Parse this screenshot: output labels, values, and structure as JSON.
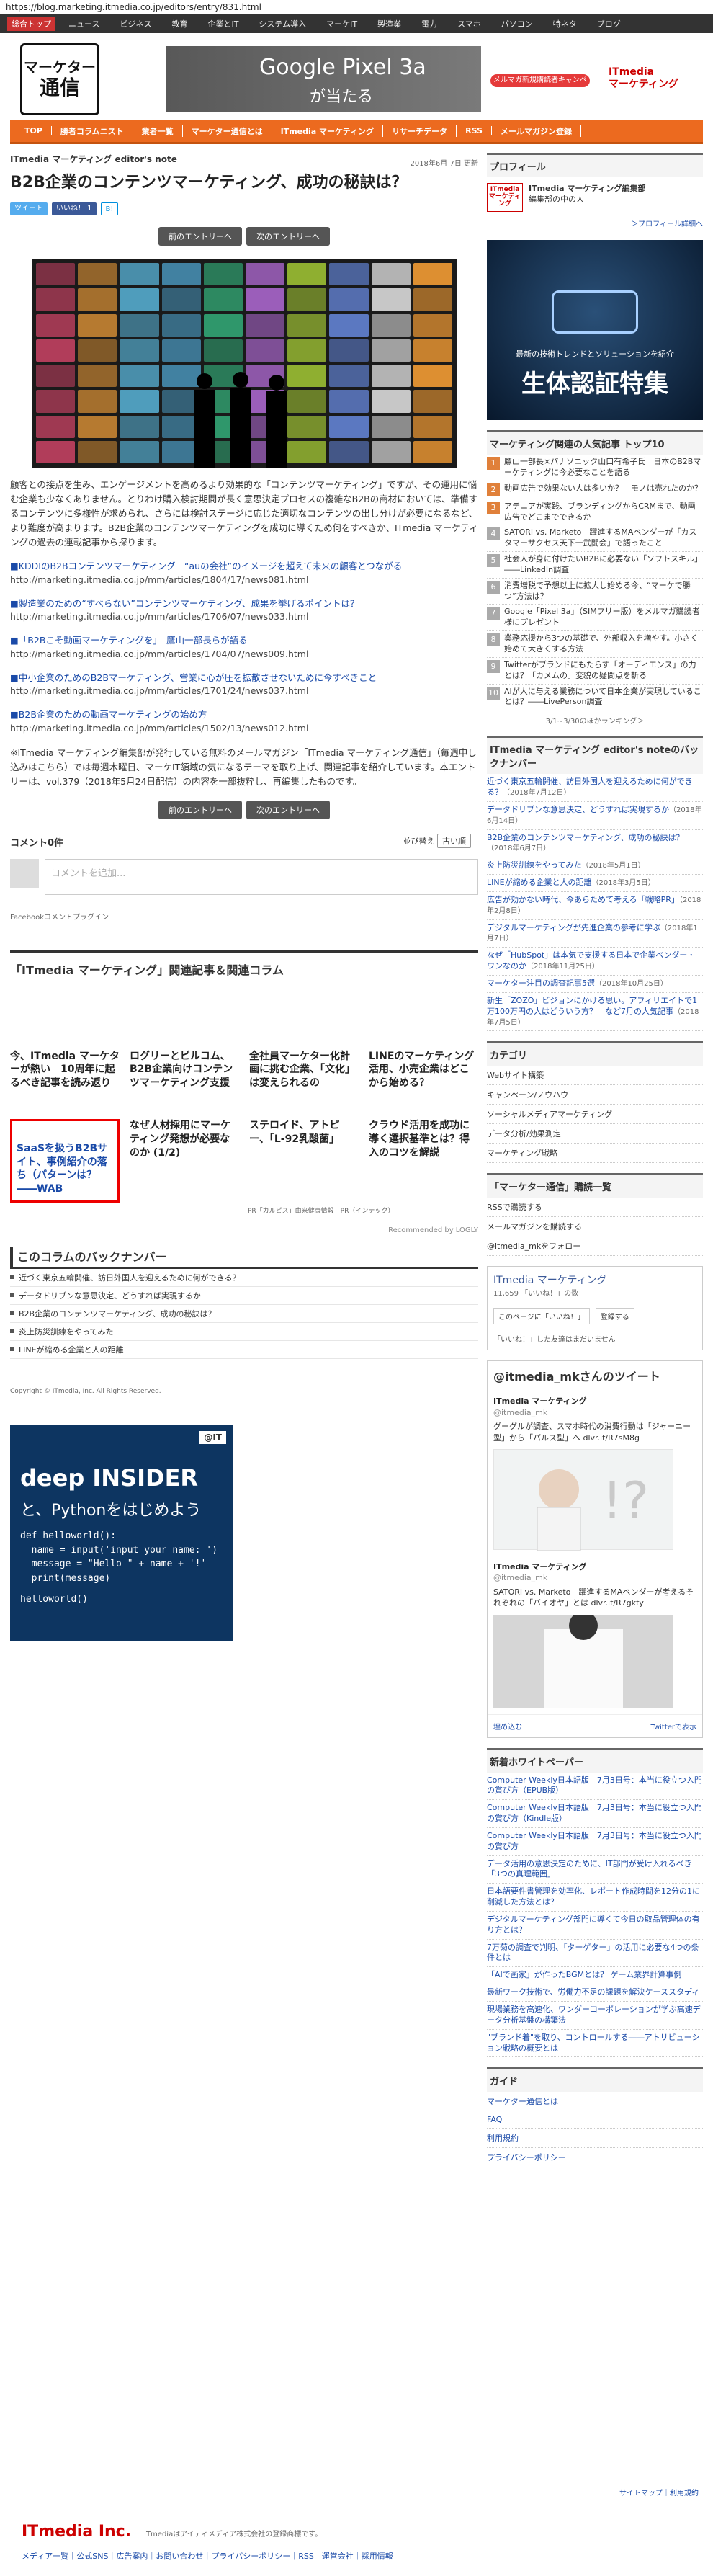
{
  "url": "https://blog.marketing.itmedia.co.jp/editors/entry/831.html",
  "topnav": [
    "総合トップ",
    "ニュース",
    "ビジネス",
    "教育",
    "企業とIT",
    "システム導入",
    "マーケIT",
    "製造業",
    "電力",
    "スマホ",
    "パソコン",
    "特ネタ",
    "ブログ"
  ],
  "logo": {
    "l1": "マーケター",
    "l2": "通信"
  },
  "banner": {
    "t1": "Google Pixel 3a",
    "t2": "が当たる",
    "cta": "メルマガ新規購読者キャンペーン",
    "brand1": "ITmedia",
    "brand2": "マーケティング"
  },
  "orangenav": [
    "TOP",
    "勝者コラムニスト",
    "業者一覧",
    "マーケター通信とは",
    "ITmedia マーケティング",
    "リサーチデータ",
    "RSS",
    "メールマガジン登録"
  ],
  "article": {
    "eyebrow": "ITmedia マーケティング editor's note",
    "date": "2018年6月 7日 更新",
    "title": "B2B企業のコンテンツマーケティング、成功の秘訣は？",
    "tweet": "ツイート",
    "like": "いいね！ 1",
    "hatena": "B!",
    "prev": "前のエントリーへ",
    "next": "次のエントリーへ",
    "para1": "顧客との接点を生み、エンゲージメントを高めるより効果的な「コンテンツマーケティング」ですが、その運用に悩む企業も少なくありません。とりわけ購入検討期間が長く意思決定プロセスの複雑なB2Bの商材においては、準備するコンテンツに多様性が求められ、さらには検討ステージに応じた適切なコンテンツの出し分けが必要になるなど、より難度が高まります。B2B企業のコンテンツマーケティングを成功に導くため何をすべきか、ITmedia マーケティングの過去の連載記事から探ります。",
    "links": [
      {
        "h": "■KDDIのB2Bコンテンツマーケティング　“auの会社”のイメージを超えて未来の顧客とつながる",
        "u": "http://marketing.itmedia.co.jp/mm/articles/1804/17/news081.html"
      },
      {
        "h": "■製造業のための“すべらない”コンテンツマーケティング、成果を挙げるポイントは？",
        "u": "http://marketing.itmedia.co.jp/mm/articles/1706/07/news033.html"
      },
      {
        "h": "■「B2Bこそ動画マーケティングを」　鷹山一部長らが語る",
        "u": "http://marketing.itmedia.co.jp/mm/articles/1704/07/news009.html"
      },
      {
        "h": "■中小企業のためのB2Bマーケティング、営業に心が圧を拡散させないために今すべきこと",
        "u": "http://marketing.itmedia.co.jp/mm/articles/1701/24/news037.html"
      },
      {
        "h": "■B2B企業のための動画マーケティングの始め方",
        "u": "http://marketing.itmedia.co.jp/mm/articles/1502/13/news012.html"
      }
    ],
    "para2": "※ITmedia マーケティング編集部が発行している無料のメールマガジン「ITmedia マーケティング通信」（毎週申し込みはこちら）では毎週木曜日、マーケIT領域の気になるテーマを取り上げ、関連記事を紹介しています。本エントリーは、vol.379（2018年5月24日配信）の内容を一部抜粋し、再編集したものです。"
  },
  "comments": {
    "title": "コメント0件",
    "sort_label": "並び替え",
    "sort_value": "古い順",
    "placeholder": "コメントを追加...",
    "plugin": "Facebookコメントプラグイン"
  },
  "related": {
    "title": "「ITmedia マーケティング」関連記事＆関連コラム",
    "row1": [
      "今、ITmedia マーケターが熱い　10周年に起るべき記事を読み返り",
      "ログリーとビルコム、B2B企業向けコンテンツマーケティング支援",
      "全社員マーケター化計画に挑む企業、「文化」は変えられるの",
      "LINEのマーケティング活用、小売企業はどこから始める？"
    ],
    "row2": [
      "SaaSを扱うB2Bサイト、事例紹介の落ち（パターンは？ ――WAB",
      "なぜ人材採用にマーケティング発想が必要なのか (1/2)",
      "ステロイド、アトピー、「L-92乳酸菌」",
      "クラウド活用を成功に導く選択基準とは？得入のコツを解説"
    ],
    "pr": "PR「カルピス」由来健康情報　PR（インテック）",
    "recommended": "Recommended by LOGLY"
  },
  "backnumber": {
    "title": "このコラムのバックナンバー",
    "items": [
      "近づく東京五輪開催、訪日外国人を迎えるために何ができる？",
      "データドリブンな意思決定、どうすれば実現するか",
      "B2B企業のコンテンツマーケティング、成功の秘訣は？",
      "炎上防災訓練をやってみた",
      "LINEが縮める企業と人の距離"
    ]
  },
  "copyright": "Copyright © ITmedia, Inc. All Rights Reserved.",
  "deep": {
    "ac": "@IT",
    "logo": "deep INSIDER",
    "sub": "と、Pythonをはじめよう",
    "code": [
      "def helloworld():",
      "  name = input('input your name: ')",
      "  message = \"Hello \" + name + '!'",
      "  print(message)",
      "",
      "helloworld()"
    ]
  },
  "side": {
    "profile_title": "プロフィール",
    "profile_logo": "ITmedia マーケティング",
    "profile_name": "ITmedia マーケティング編集部",
    "profile_desc": "編集部の中の人",
    "profile_more": "＞プロフィール詳細へ",
    "ad_line": "最新の技術トレンドとソリューションを紹介",
    "ad_big": "生体認証特集",
    "ranking_title": "マーケティング関連の人気記事 トップ10",
    "ranking": [
      "鷹山一部長×パナソニック山口有希子氏　日本のB2Bマーケティングに今必要なことを語る",
      "動画広告で効果ない人は多いか？　モノは売れたのか？",
      "アテニアが実践、ブランディングからCRMまで、動画広告でどこまでできるか",
      "SATORI vs. Marketo　躍進するMAベンダーが「カスタマーサクセス天下一武闘会」で語ったこと",
      "社会人が身に付けたいB2Bに必要ない「ソフトスキル」――LinkedIn調査",
      "消費増税で予想以上に拡大し始める今、“マーケで勝つ”方法は？",
      "Google「Pixel 3a」（SIMフリー版）をメルマガ購読者様にプレゼント",
      "業務応援から3つの基礎で、外部収入を増やす。小さく始めて大きくする方法",
      "Twitterがブランドにもたらす「オーディエンス」の力とは？「カメムの」変貌の疑問点を斬る",
      "AIが人に与える業務について日本企業が実現していることは？――LivePerson調査"
    ],
    "ranking_foot": "3/1~3/30のほかランキング＞",
    "entries_title": "ITmedia マーケティング editor's noteのバックナンバー",
    "entries": [
      [
        "近づく東京五輪開催、訪日外国人を迎えるために何ができる？",
        "（2018年7月12日）"
      ],
      [
        "データドリブンな意思決定、どうすれば実現するか",
        "（2018年6月14日）"
      ],
      [
        "B2B企業のコンテンツマーケティング、成功の秘訣は？",
        "（2018年6月7日）"
      ],
      [
        "炎上防災訓練をやってみた",
        "（2018年5月1日）"
      ],
      [
        "LINEが縮める企業と人の距離",
        "（2018年3月5日）"
      ],
      [
        "広告が効かない時代、今あらためて考える「戦略PR」",
        "（2018年2月8日）"
      ],
      [
        "デジタルマーケティングが先進企業の参考に学ぶ",
        "（2018年1月7日）"
      ],
      [
        "なぜ「HubSpot」は本気で支援する日本で企業ベンダー・ワンなのか",
        "（2018年11月25日）"
      ],
      [
        "マーケター注目の調査記事5選",
        "（2018年10月25日）"
      ],
      [
        "新生「ZOZO」ビジョンにかける思い。アフィリエイトで1万100万円の人はどういう方？　など7月の人気記事",
        "（2018年7月5日）"
      ]
    ],
    "cat_title": "カテゴリ",
    "cats": [
      "Webサイト構築",
      "キャンペーン/ノウハウ",
      "ソーシャルメディアマーケティング",
      "データ分析/効果測定",
      "マーケティング戦略"
    ],
    "mag_title": "「マーケター通信」購読一覧",
    "mag": [
      "RSSで購読する",
      "メールマガジンを購読する",
      "@itmedia_mkをフォロー"
    ],
    "fb_name": "ITmedia マーケティング",
    "fb_likes": "11,659 「いいね！」の数",
    "fb_like_btn": "このページに「いいね！」",
    "fb_sub_btn": "登録する",
    "fb_foot": "「いいね！」した友達はまだいません",
    "tw_title": "@itmedia_mkさんのツイート",
    "tw_name": "ITmedia マーケティング",
    "tw_handle": "@itmedia_mk",
    "tw_text1": "グーグルが調査、スマホ時代の消費行動は「ジャーニー型」から「パルス型」へ dlvr.it/R7sM8g",
    "tw_text2": "SATORI vs. Marketo　躍進するMAベンダーが考えるそれぞれの「バイオヤ」とは dlvr.it/R7gkty",
    "tw_embed": "埋め込む",
    "tw_view": "Twitterで表示",
    "wp_title": "新着ホワイトペーパー",
    "wp": [
      "Computer Weekly日本語版　7月3日号：本当に役立つ入門の賞び方（EPUB版）",
      "Computer Weekly日本語版　7月3日号：本当に役立つ入門の賞び方（Kindle版）",
      "Computer Weekly日本語版　7月3日号：本当に役立つ入門の賞び方",
      "データ活用の意思決定のために、IT部門が受け入れるべき「3つの真理範囲」",
      "日本語要件書管理を効率化、レポート作成時間を12分の1に削減した方法とは？",
      "デジタルマーケティング部門に導くて今日の取品管理体の有り方とは？",
      "7万菊の調査で判明、「ターゲター」の活用に必要な4つの条件とは",
      "「AIで画家」が作ったBGMとは？ ゲーム業界計算事例",
      "最新ワーク技術で、労働力不足の課題を解決ケーススタディ",
      "現場業務を高速化、ワンダーコーポレーションが学ぶ高速データ分析基盤の構築法",
      "\"ブランド着\"を取り、コントロールする――アトリビューション戦略の概要とは"
    ],
    "guide_title": "ガイド",
    "guide": [
      "マーケター通信とは",
      "FAQ",
      "利用規約",
      "プライバシーポリシー"
    ]
  },
  "footer": {
    "sitemap": "サイトマップ｜利用規約",
    "logo": "ITmedia Inc.",
    "desc": "ITmediaはアイティメディア株式会社の登録商標です。",
    "links": "メディア一覧｜公式SNS｜広告案内｜お問い合わせ｜プライバシーポリシー｜RSS｜運営会社｜採用情報"
  }
}
